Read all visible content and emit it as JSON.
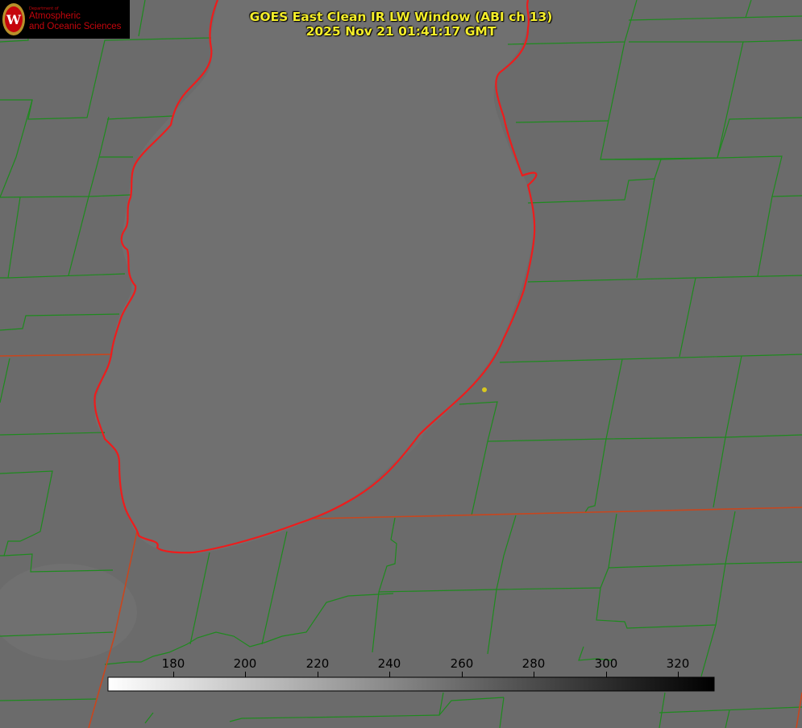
{
  "title": {
    "line1": "GOES East Clean IR LW Window (ABI ch 13)",
    "line2": "2025 Nov 21 01:41:17 GMT"
  },
  "logo": {
    "dept": "Department of",
    "line1": "Atmospheric",
    "line2": "and Oceanic Sciences",
    "seal_letter": "W"
  },
  "colorbar": {
    "ticks": [
      "180",
      "200",
      "220",
      "240",
      "260",
      "280",
      "300",
      "320"
    ],
    "gradient_start": "#ffffff",
    "gradient_end": "#000000"
  },
  "colors": {
    "background": "#6b6b6b",
    "lake": "#6f6f6f",
    "county_lines": "#1e8a1e",
    "state_lines": "#c8461e",
    "shoreline": "#ee1c1c",
    "title_text": "#f5ee2a",
    "marker": "#d8c81e"
  }
}
